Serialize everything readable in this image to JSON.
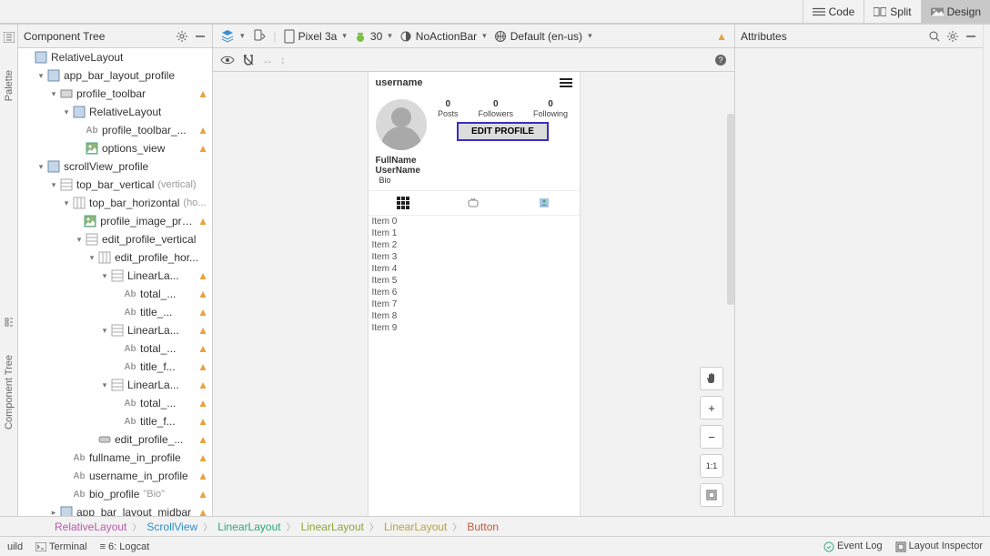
{
  "viewSwitcher": {
    "code": "Code",
    "split": "Split",
    "design": "Design"
  },
  "sideTabs": {
    "palette": "Palette",
    "componentTree": "Component Tree"
  },
  "treePanel": {
    "title": "Component Tree"
  },
  "tree": [
    {
      "depth": 0,
      "expand": "none",
      "icon": "rel",
      "label": "RelativeLayout",
      "extra": "",
      "warn": false
    },
    {
      "depth": 1,
      "expand": "open",
      "icon": "rel",
      "label": "app_bar_layout_profile",
      "extra": "",
      "warn": false
    },
    {
      "depth": 2,
      "expand": "open",
      "icon": "tool",
      "label": "profile_toolbar",
      "extra": "",
      "warn": true
    },
    {
      "depth": 3,
      "expand": "open",
      "icon": "rel",
      "label": "RelativeLayout",
      "extra": "",
      "warn": false
    },
    {
      "depth": 4,
      "expand": "leaf",
      "icon": "ab",
      "label": "profile_toolbar_...",
      "extra": "",
      "warn": true
    },
    {
      "depth": 4,
      "expand": "leaf",
      "icon": "img",
      "label": "options_view",
      "extra": "",
      "warn": true
    },
    {
      "depth": 1,
      "expand": "open",
      "icon": "rel",
      "label": "scrollView_profile",
      "extra": "",
      "warn": false
    },
    {
      "depth": 2,
      "expand": "open",
      "icon": "v",
      "label": "top_bar_vertical",
      "extra": "(vertical)",
      "warn": false
    },
    {
      "depth": 3,
      "expand": "open",
      "icon": "h",
      "label": "top_bar_horizontal",
      "extra": "(ho...",
      "warn": false
    },
    {
      "depth": 4,
      "expand": "leaf",
      "icon": "img",
      "label": "profile_image_prof...",
      "extra": "",
      "warn": true
    },
    {
      "depth": 4,
      "expand": "open",
      "icon": "v",
      "label": "edit_profile_vertical",
      "extra": "",
      "warn": false
    },
    {
      "depth": 5,
      "expand": "open",
      "icon": "h",
      "label": "edit_profile_hor...",
      "extra": "",
      "warn": false
    },
    {
      "depth": 6,
      "expand": "open",
      "icon": "v",
      "label": "LinearLa...",
      "extra": "",
      "warn": true
    },
    {
      "depth": 7,
      "expand": "leaf",
      "icon": "ab",
      "label": "total_...",
      "extra": "",
      "warn": true
    },
    {
      "depth": 7,
      "expand": "leaf",
      "icon": "ab",
      "label": "title_...",
      "extra": "",
      "warn": true
    },
    {
      "depth": 6,
      "expand": "open",
      "icon": "v",
      "label": "LinearLa...",
      "extra": "",
      "warn": true
    },
    {
      "depth": 7,
      "expand": "leaf",
      "icon": "ab",
      "label": "total_...",
      "extra": "",
      "warn": true
    },
    {
      "depth": 7,
      "expand": "leaf",
      "icon": "ab",
      "label": "title_f...",
      "extra": "",
      "warn": true
    },
    {
      "depth": 6,
      "expand": "open",
      "icon": "v",
      "label": "LinearLa...",
      "extra": "",
      "warn": true
    },
    {
      "depth": 7,
      "expand": "leaf",
      "icon": "ab",
      "label": "total_...",
      "extra": "",
      "warn": true
    },
    {
      "depth": 7,
      "expand": "leaf",
      "icon": "ab",
      "label": "title_f...",
      "extra": "",
      "warn": true
    },
    {
      "depth": 5,
      "expand": "leaf",
      "icon": "btn",
      "label": "edit_profile_...",
      "extra": "",
      "warn": true
    },
    {
      "depth": 3,
      "expand": "leaf",
      "icon": "ab",
      "label": "fullname_in_profile",
      "extra": "",
      "warn": true
    },
    {
      "depth": 3,
      "expand": "leaf",
      "icon": "ab",
      "label": "username_in_profile",
      "extra": "",
      "warn": true
    },
    {
      "depth": 3,
      "expand": "leaf",
      "icon": "ab",
      "label": "bio_profile",
      "extra": "\"Bio\"",
      "warn": true
    },
    {
      "depth": 2,
      "expand": "closed",
      "icon": "rel",
      "label": "app_bar_layout_midbar",
      "extra": "",
      "warn": true
    }
  ],
  "designToolbar": {
    "device": "Pixel 3a",
    "api": "30",
    "theme": "NoActionBar",
    "locale": "Default (en-us)"
  },
  "phone": {
    "username": "username",
    "posts_n": "0",
    "posts_l": "Posts",
    "followers_n": "0",
    "followers_l": "Followers",
    "following_n": "0",
    "following_l": "Following",
    "editBtn": "EDIT PROFILE",
    "fullname": "FullName",
    "uname": "UserName",
    "bio": "Bio",
    "items": [
      "Item 0",
      "Item 1",
      "Item 2",
      "Item 3",
      "Item 4",
      "Item 5",
      "Item 6",
      "Item 7",
      "Item 8",
      "Item 9"
    ]
  },
  "zoom": {
    "plus": "+",
    "minus": "−",
    "fit": "1:1"
  },
  "attrPanel": {
    "title": "Attributes"
  },
  "breadcrumb": [
    {
      "label": "RelativeLayout",
      "color": "#b85aa8"
    },
    {
      "label": "ScrollView",
      "color": "#2f8fd0"
    },
    {
      "label": "LinearLayout",
      "color": "#2fa676"
    },
    {
      "label": "LinearLayout",
      "color": "#8aa63a"
    },
    {
      "label": "LinearLayout",
      "color": "#b8a33a"
    },
    {
      "label": "Button",
      "color": "#c05a3a"
    }
  ],
  "status": {
    "left": [
      "uild",
      "Terminal",
      "Logcat"
    ],
    "leftPrefix": [
      "",
      "",
      "≡ 6: "
    ],
    "right": [
      "Event Log",
      "Layout Inspector"
    ]
  }
}
